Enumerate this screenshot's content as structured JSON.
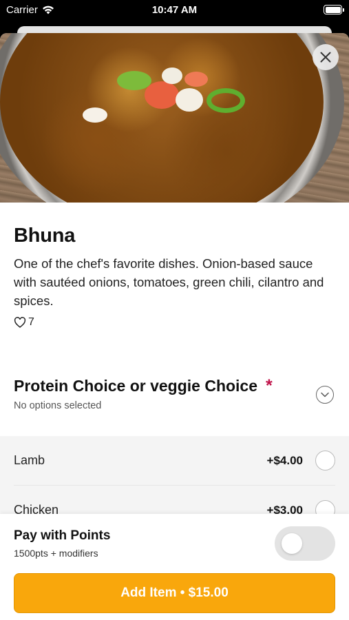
{
  "status_bar": {
    "carrier": "Carrier",
    "time": "10:47 AM"
  },
  "item": {
    "title": "Bhuna",
    "description": "One of the chef's favorite dishes. Onion-based sauce with sautéed onions, tomatoes, green chili, cilantro and spices.",
    "likes": "7"
  },
  "option_group": {
    "title": "Protein Choice or veggie Choice",
    "required_mark": "*",
    "subtitle": "No options selected",
    "options": [
      {
        "label": "Lamb",
        "price": "+$4.00"
      },
      {
        "label": "Chicken",
        "price": "+$3.00"
      }
    ]
  },
  "footer": {
    "points_title": "Pay with Points",
    "points_sub": "1500pts + modifiers",
    "points_enabled": false,
    "add_button": "Add Item • $15.00"
  },
  "colors": {
    "accent": "#f9a70c",
    "required": "#c0134a"
  }
}
